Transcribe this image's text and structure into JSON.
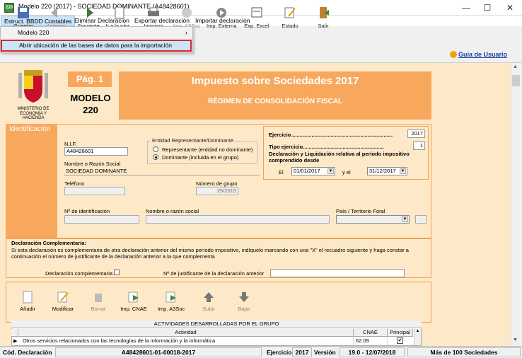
{
  "window": {
    "title": "Modelo 220 (2017) - SOCIEDAD DOMINANTE (A48428601)",
    "controls": {
      "minimize": "—",
      "maximize": "☐",
      "close": "✕"
    }
  },
  "menu": [
    "Estruct. BBDD Contables",
    "Eliminar Declaracion",
    "Exportar declaración",
    "Importar declaración"
  ],
  "dropdown": {
    "items": [
      {
        "label": "Modelo 220",
        "arrow": "›"
      },
      {
        "label": "Abrir ubicación de las bases de datos para la importación"
      }
    ]
  },
  "toolbar": {
    "buttons": [
      {
        "label": "Guardar",
        "enabled": true
      },
      {
        "label": "Anterior",
        "enabled": false
      },
      {
        "label": "Siguiente",
        "enabled": true
      },
      {
        "label": "Ir a la pág...",
        "enabled": true
      },
      {
        "label": "Imprimir",
        "enabled": true
      },
      {
        "label": "Imp. A3Soc",
        "enabled": false
      },
      {
        "label": "Imp. Externa",
        "enabled": true
      },
      {
        "label": "Exp. Excel",
        "enabled": true
      },
      {
        "label": "Estado",
        "enabled": true
      },
      {
        "label": "Salir",
        "enabled": true
      }
    ],
    "help": "Guía de Usuario"
  },
  "ministry": "MINISTERIO DE ECONOMÍA Y HACIENDA",
  "header": {
    "page": "Pág. 1",
    "modelo": "MODELO",
    "modelo_num": "220",
    "title": "Impuesto sobre Sociedades  2017",
    "subtitle": "RÉGIMEN DE CONSOLIDACIÓN FISCAL"
  },
  "identificacion": {
    "section": "Identificación",
    "nif_label": "N.I.F.",
    "nif": "A48428601",
    "entidad_legend": "Entidad Representante/Dominante",
    "radio1": "Representante (entidad no dominante)",
    "radio2": "Dominante (incluida en el grupo)",
    "razon_label": "Nombre o Razón Social",
    "razon": "SOCIEDAD DOMINANTE",
    "telefono_label": "Teléfono",
    "telefono": "",
    "grupo_label": "Número de grupo",
    "grupo": "25/2015",
    "num_id_label": "Nº de identificación",
    "nombre_label": "Nombre o razón social",
    "pais_label": "País / Territorio Foral"
  },
  "ejercicio": {
    "label": "Ejercicio.....................................................................",
    "value": "2017",
    "tipo_label": "Tipo ejercicio.......................................................",
    "tipo": "1",
    "decl_label": "Declaración y Liquidación relativa al período impositivo comprendido desde",
    "el": "El",
    "desde": "01/01/2017",
    "yel": "y el",
    "hasta": "31/12/2017"
  },
  "complementaria": {
    "title": "Declaración Complementaria:",
    "text": "Si esta declaración es complementaria de otra declaración anterior del mismo período impositivo, indíquelo marcando con una \"X\" el recuadro siguiente y haga constar a continuación el número de justificante de la declaración anterior a la que complementa",
    "check_label": "Declaración complementaria",
    "just_label": "Nº de justificante de la declaración anterior"
  },
  "actividades": {
    "buttons": [
      {
        "label": "Añadir",
        "enabled": true
      },
      {
        "label": "Modificar",
        "enabled": true
      },
      {
        "label": "Borrar",
        "enabled": false
      },
      {
        "label": "Imp. CNAE",
        "enabled": true
      },
      {
        "label": "Imp. A3Soc",
        "enabled": true
      },
      {
        "label": "Subir",
        "enabled": false
      },
      {
        "label": "Bajar",
        "enabled": false
      }
    ],
    "title": "ACTIVIDADES DESARROLLADAS POR EL GRUPO",
    "columns": [
      "Actividad",
      "CNAE",
      "Principal"
    ],
    "rows": [
      {
        "actividad": "Otros servicios relacionados con las tecnologías de la información y la informática",
        "cnae": "62.09",
        "principal": "✔"
      }
    ]
  },
  "status": {
    "cod_label": "Cód. Declaración",
    "cod": "A48428601-01-00018-2017",
    "ejercicio_label": "Ejercicio",
    "ejercicio": "2017",
    "version_label": "Versión",
    "version": "19.0 - 12/07/2018",
    "sociedades": "Más de 100 Sociedades"
  },
  "colors": {
    "orange": "#f8a85c",
    "form_bg": "#fde9c8",
    "highlight_border": "#d22a2a"
  }
}
